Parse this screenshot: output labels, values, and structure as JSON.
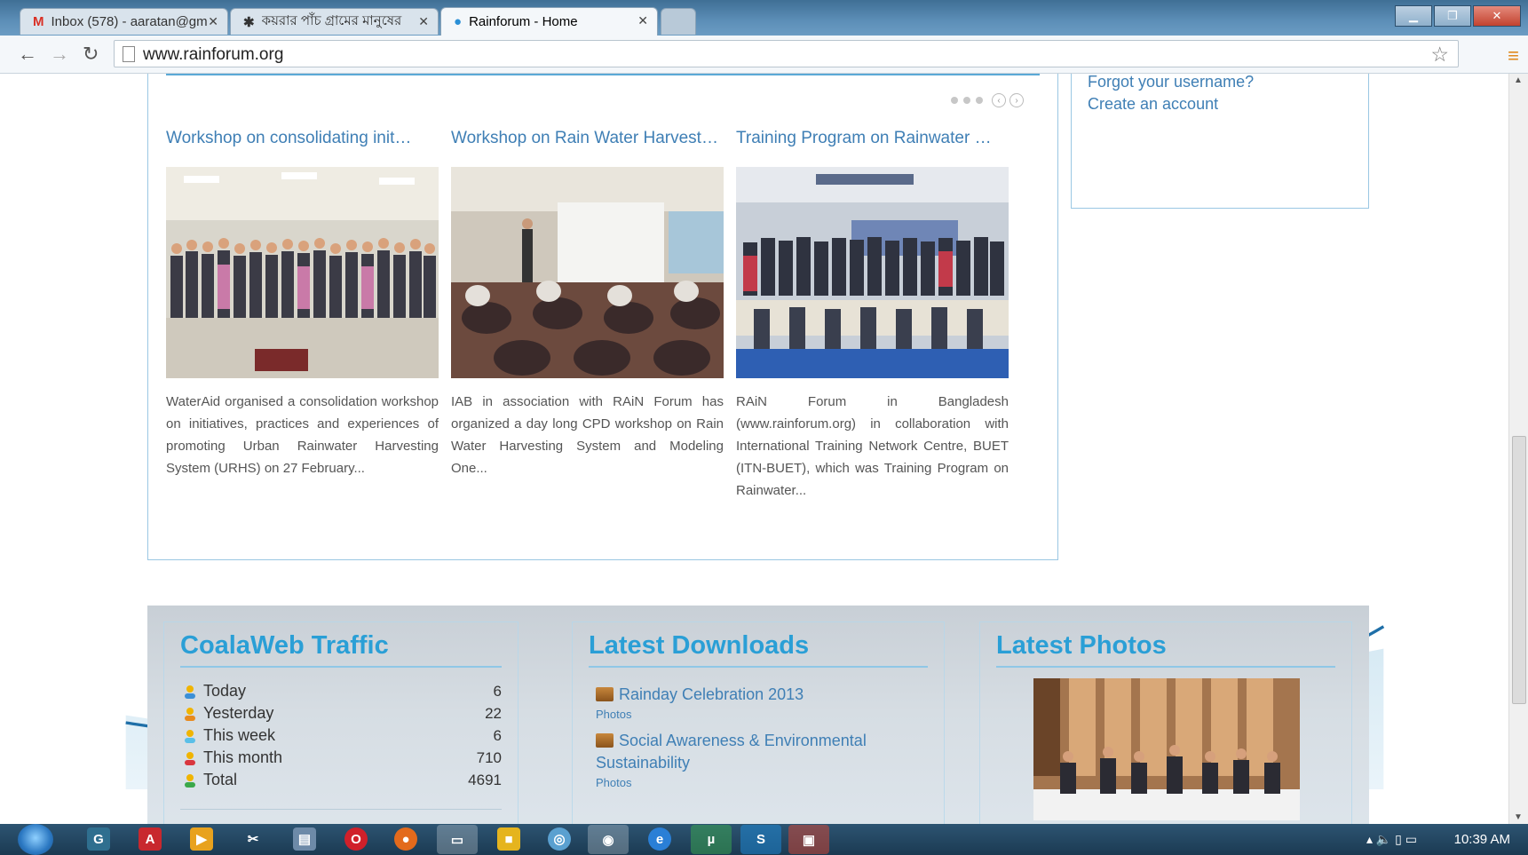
{
  "browser": {
    "tabs": [
      {
        "icon": "gmail-icon",
        "title": "Inbox (578) - aaratan@gm"
      },
      {
        "icon": "globe-icon",
        "title": "কয়রার পাঁচ গ্রামের মানুষের"
      },
      {
        "icon": "rain-drop-icon",
        "title": "Rainforum - Home"
      }
    ],
    "url": "www.rainforum.org",
    "window_buttons": {
      "minimize": "▁",
      "maximize": "❐",
      "close": "✕"
    }
  },
  "news": {
    "items": [
      {
        "title": "Workshop on consolidating init…",
        "description": "WaterAid organised a consolidation workshop on initiatives, practices and experiences of promoting Urban Rainwater Harvesting System (URHS) on 27 February..."
      },
      {
        "title": "Workshop on Rain Water Harvest…",
        "description": "IAB in association with RAiN Forum has organized a day long CPD workshop on Rain Water Harvesting System and Modeling One..."
      },
      {
        "title": "Training Program on Rainwater …",
        "description": "RAiN Forum in Bangladesh (www.rainforum.org) in collaboration with International Training Network Centre, BUET (ITN-BUET), which was Training Program on Rainwater..."
      }
    ]
  },
  "login": {
    "forgot_username": "Forgot your username?",
    "create_account": "Create an account"
  },
  "footer": {
    "traffic": {
      "heading": "CoalaWeb Traffic",
      "rows": [
        {
          "label": "Today",
          "value": "6"
        },
        {
          "label": "Yesterday",
          "value": "22"
        },
        {
          "label": "This week",
          "value": "6"
        },
        {
          "label": "This month",
          "value": "710"
        },
        {
          "label": "Total",
          "value": "4691"
        }
      ]
    },
    "downloads": {
      "heading": "Latest Downloads",
      "items": [
        {
          "title": "Rainday Celebration 2013",
          "category": "Photos"
        },
        {
          "title": "Social Awareness & Environmental Sustainability",
          "category": "Photos"
        }
      ]
    },
    "photos": {
      "heading": "Latest Photos"
    }
  },
  "taskbar": {
    "clock": "10:39 AM"
  },
  "colors": {
    "link": "#3f7fb5",
    "heading": "#2a9fd6",
    "border": "#9ac7e3"
  }
}
